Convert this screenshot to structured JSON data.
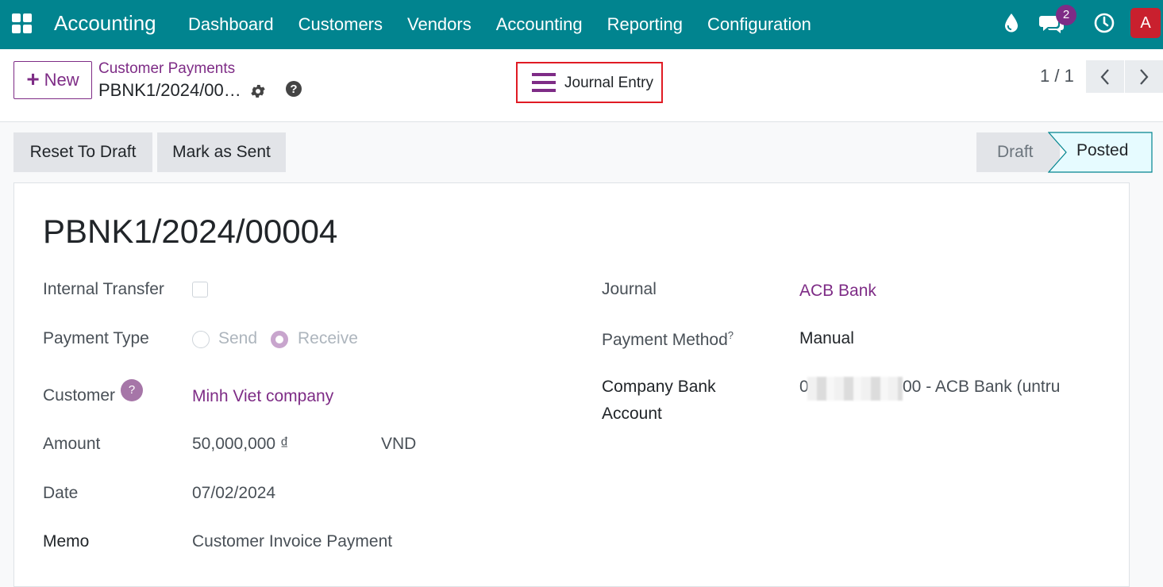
{
  "navbar": {
    "app_name": "Accounting",
    "menu": [
      "Dashboard",
      "Customers",
      "Vendors",
      "Accounting",
      "Reporting",
      "Configuration"
    ],
    "messages_count": "2",
    "user_initial": "A",
    "color": "#01848f"
  },
  "control_panel": {
    "new_label": "New",
    "breadcrumb_parent": "Customer Payments",
    "breadcrumb_current": "PBNK1/2024/00…",
    "smart_button_label": "Journal Entry",
    "pager": "1 / 1"
  },
  "statusbar": {
    "buttons": [
      "Reset To Draft",
      "Mark as Sent"
    ],
    "stages": [
      "Draft",
      "Posted"
    ],
    "current_stage": "Posted"
  },
  "form": {
    "title": "PBNK1/2024/00004",
    "left": {
      "internal_transfer_label": "Internal Transfer",
      "payment_type_label": "Payment Type",
      "payment_type_options": [
        "Send",
        "Receive"
      ],
      "payment_type_selected": "Receive",
      "customer_label": "Customer",
      "customer_help": "?",
      "customer_value": "Minh Viet company",
      "amount_label": "Amount",
      "amount_value": "50,000,000 ₫",
      "currency": "VND",
      "date_label": "Date",
      "date_value": "07/02/2024",
      "memo_label": "Memo",
      "memo_value": "Customer Invoice Payment"
    },
    "right": {
      "journal_label": "Journal",
      "journal_value": "ACB Bank",
      "payment_method_label": "Payment Method",
      "payment_method_help": "?",
      "payment_method_value": "Manual",
      "company_bank_label_1": "Company Bank",
      "company_bank_label_2": "Account",
      "company_bank_prefix": "0",
      "company_bank_value": "00 - ACB Bank (untru"
    }
  },
  "colors": {
    "accent": "#7e2c86",
    "highlight_border": "#e01b24",
    "posted_stage": "#e6fbff"
  }
}
